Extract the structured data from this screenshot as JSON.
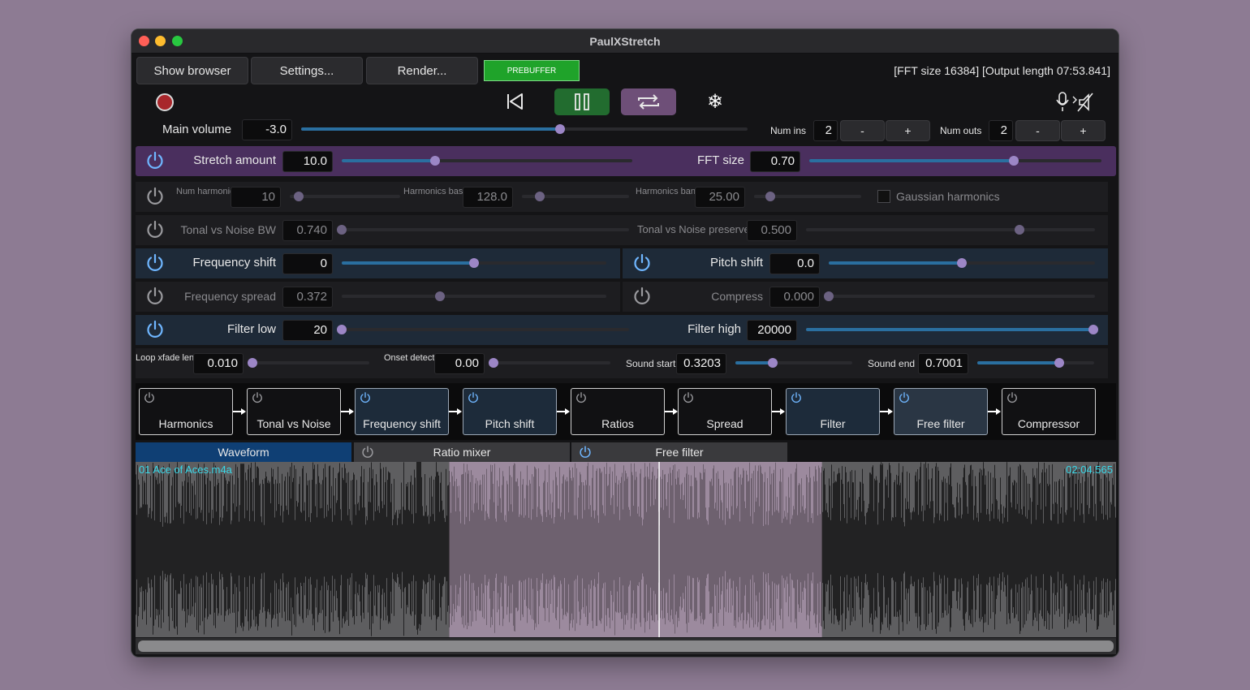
{
  "window": {
    "title": "PaulXStretch"
  },
  "toolbar": {
    "show_browser": "Show browser",
    "settings": "Settings...",
    "render": "Render...",
    "prebuffer": "PREBUFFER",
    "info": "[FFT size 16384] [Output length 07:53.841]"
  },
  "main": {
    "volume_label": "Main volume",
    "volume_value": "-3.0",
    "volume_level": 0.58,
    "num_ins_label": "Num ins",
    "num_ins_value": "2",
    "num_outs_label": "Num outs",
    "num_outs_value": "2",
    "minus": "-",
    "plus": "+"
  },
  "params": {
    "stretch_label": "Stretch amount",
    "stretch_value": "10.0",
    "stretch_level": 0.32,
    "fft_label": "FFT size",
    "fft_value": "0.70",
    "fft_level": 0.7,
    "num_harm_label": "Num harmonics",
    "num_harm_value": "10",
    "num_harm_level": 0.08,
    "harm_freq_label": "Harmonics base freq",
    "harm_freq_value": "128.0",
    "harm_freq_level": 0.17,
    "harm_bw_label": "Harmonics bandwidth",
    "harm_bw_value": "25.00",
    "harm_bw_level": 0.15,
    "gaussian_label": "Gaussian harmonics",
    "tonal_bw_label": "Tonal vs Noise BW",
    "tonal_bw_value": "0.740",
    "tonal_bw_level": 0.0,
    "tonal_pres_label": "Tonal vs Noise preserve",
    "tonal_pres_value": "0.500",
    "tonal_pres_level": 0.74,
    "freq_shift_label": "Frequency shift",
    "freq_shift_value": "0",
    "freq_shift_level": 0.5,
    "pitch_shift_label": "Pitch shift",
    "pitch_shift_value": "0.0",
    "pitch_shift_level": 0.5,
    "freq_spread_label": "Frequency spread",
    "freq_spread_value": "0.372",
    "freq_spread_level": 0.37,
    "compress_label": "Compress",
    "compress_value": "0.000",
    "compress_level": 0.0,
    "filter_low_label": "Filter low",
    "filter_low_value": "20",
    "filter_low_level": 0.0,
    "filter_high_label": "Filter high",
    "filter_high_value": "20000",
    "filter_high_level": 1.0,
    "loop_label": "Loop xfade length",
    "loop_value": "0.010",
    "loop_level": 0.0,
    "onset_label": "Onset detection",
    "onset_value": "0.00",
    "onset_level": 0.0,
    "sound_start_label": "Sound start",
    "sound_start_value": "0.3203",
    "sound_start_level": 0.32,
    "sound_end_label": "Sound end",
    "sound_end_value": "0.7001",
    "sound_end_level": 0.7
  },
  "chain": [
    "Harmonics",
    "Tonal vs Noise",
    "Frequency shift",
    "Pitch shift",
    "Ratios",
    "Spread",
    "Filter",
    "Free filter",
    "Compressor"
  ],
  "tabs": {
    "waveform": "Waveform",
    "ratio_mixer": "Ratio mixer",
    "free_filter": "Free filter"
  },
  "waveform": {
    "filename": "01 Ace of Aces.m4a",
    "duration": "02:04.565",
    "selection_start": 0.32,
    "selection_end": 0.7,
    "playhead": 0.534
  },
  "colors": {
    "accent": "#9c86c6",
    "fill": "#2a6fa0",
    "power_on": "#6fb6ff",
    "selection": "#9c8a9e",
    "waveform_text": "#38d8e8"
  }
}
